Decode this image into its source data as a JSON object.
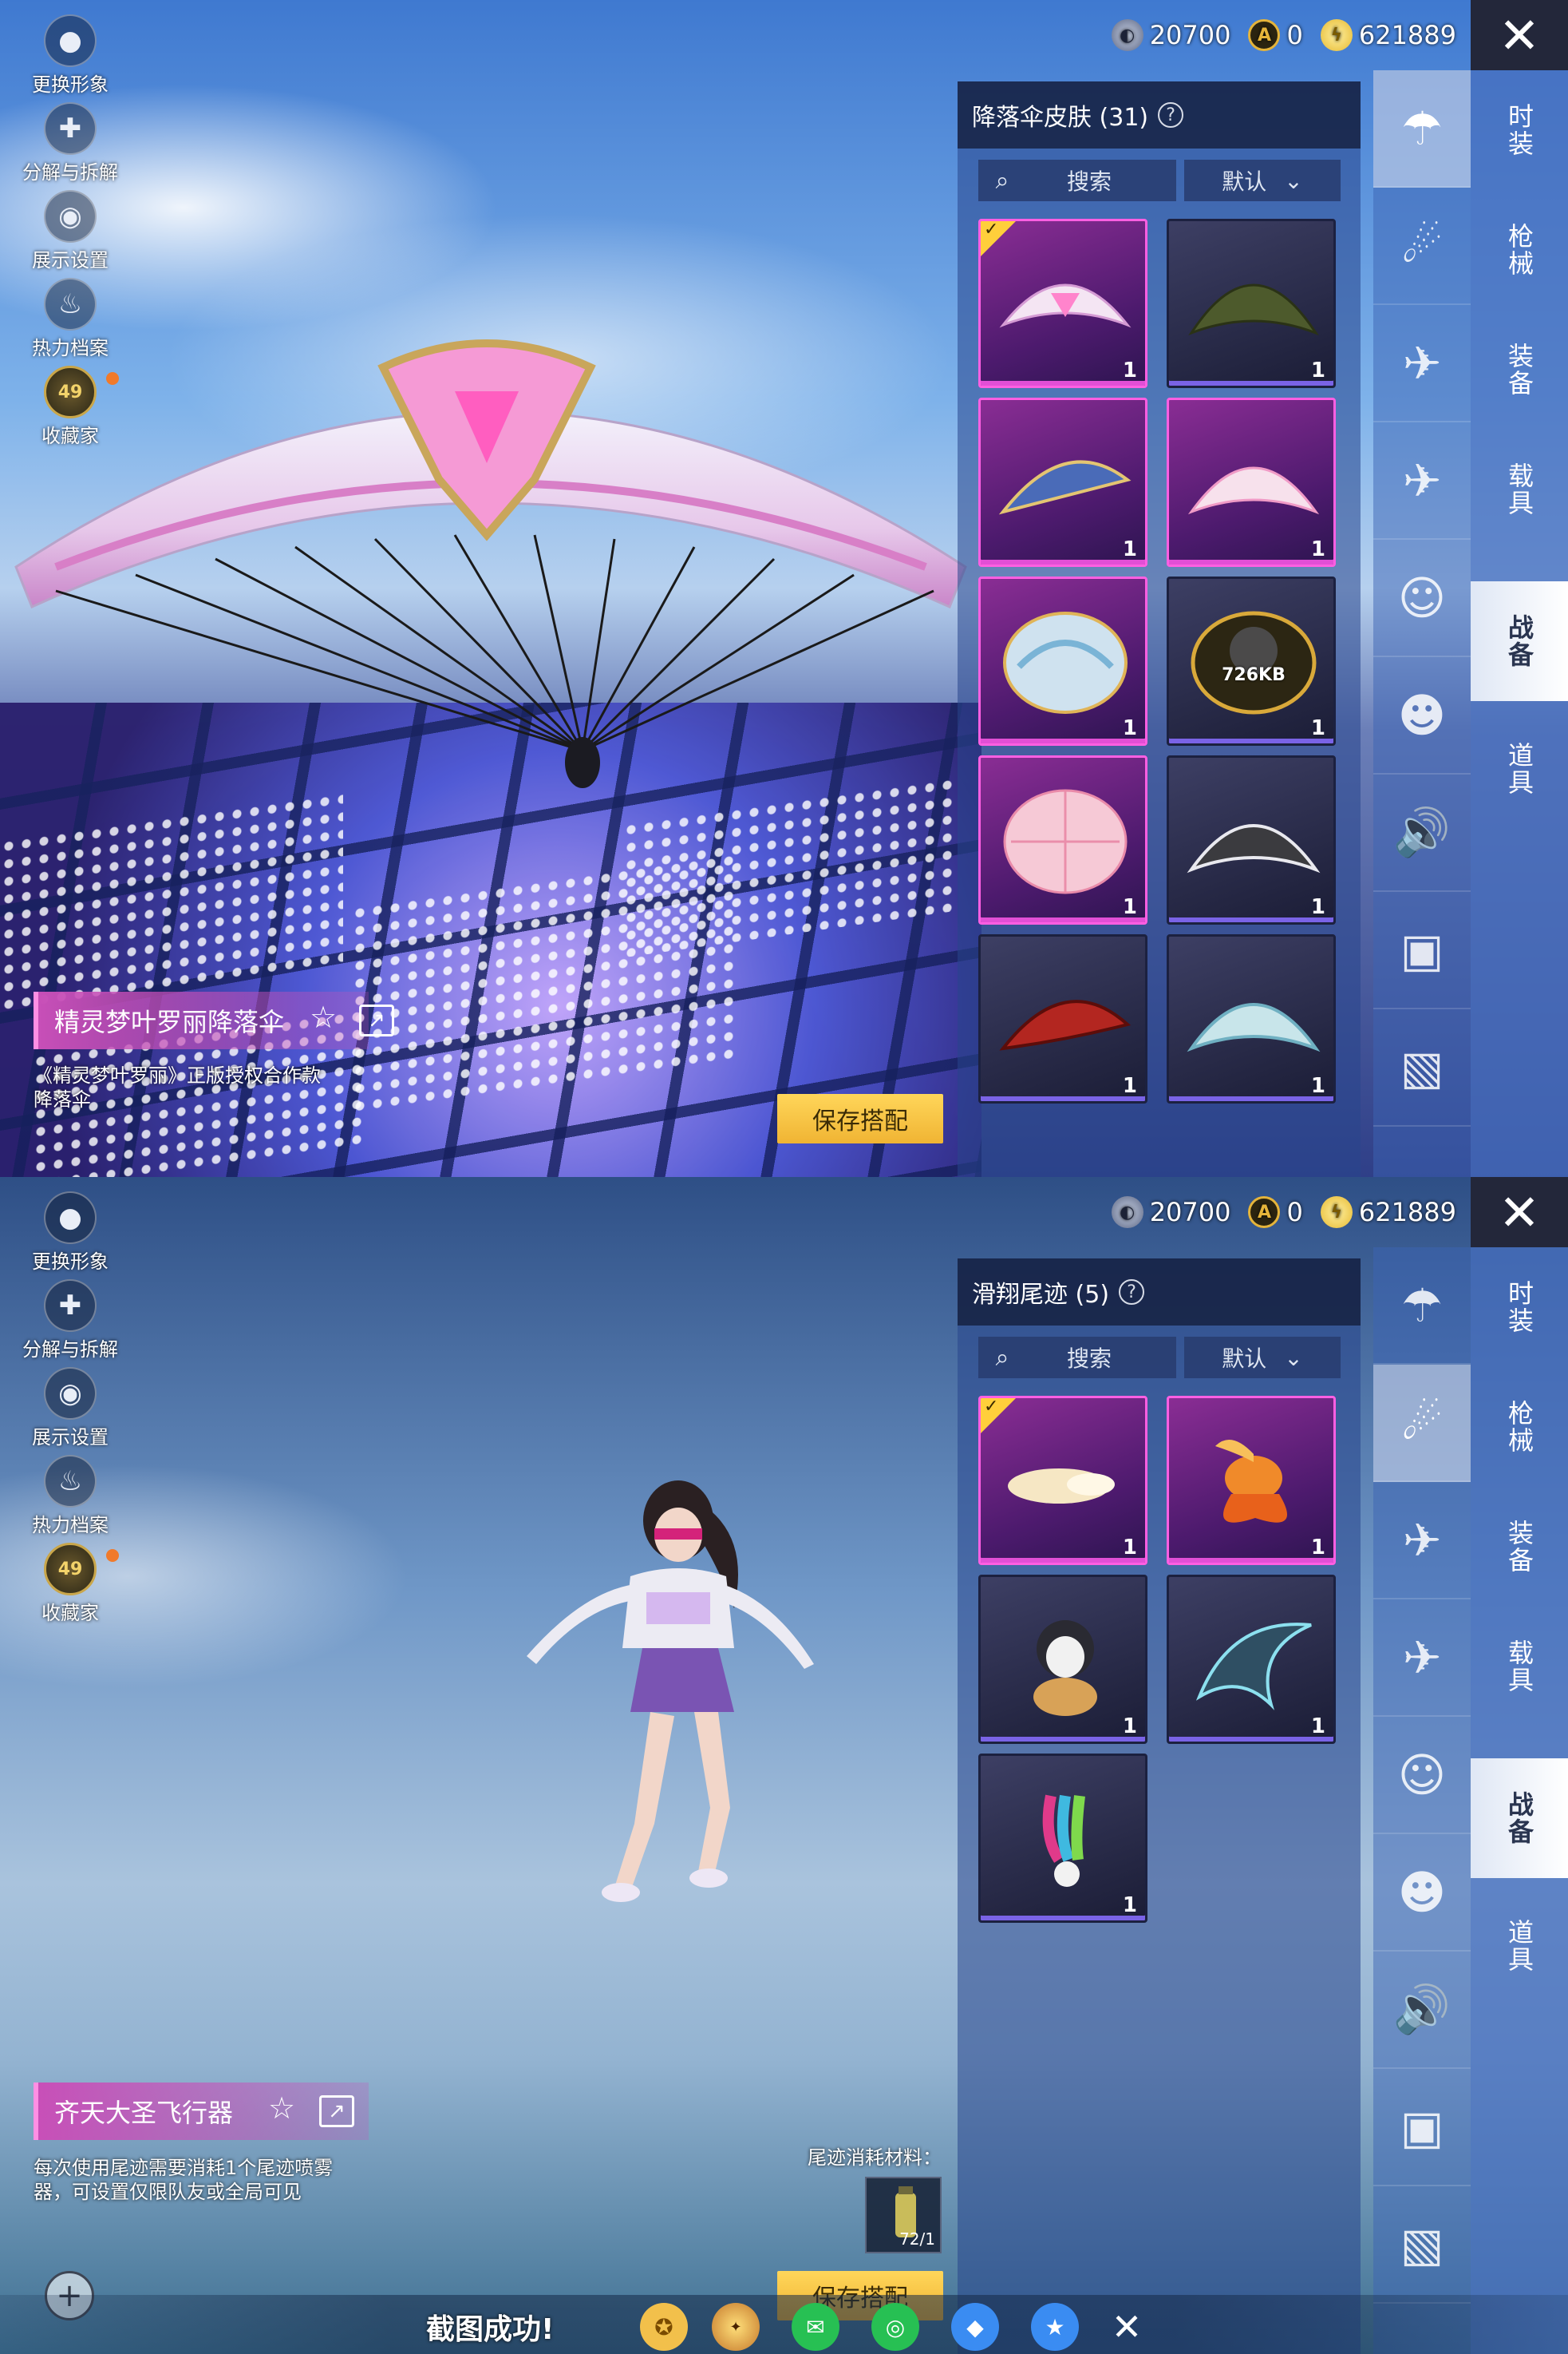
{
  "currency": {
    "coupon_value": "20700",
    "gold_value": "0",
    "coin_value": "621889"
  },
  "left_menu": {
    "items": [
      {
        "label": "更换形象",
        "icon": "avatar-icon"
      },
      {
        "label": "分解与拆解",
        "icon": "puzzle-icon"
      },
      {
        "label": "展示设置",
        "icon": "eye-icon"
      },
      {
        "label": "热力档案",
        "icon": "flame-icon"
      },
      {
        "label": "收藏家",
        "icon": "collector-level-icon",
        "level": "49"
      }
    ]
  },
  "categories": [
    "时装",
    "枪械",
    "装备",
    "载具",
    "战备",
    "道具"
  ],
  "active_category": "战备",
  "sub_icons": [
    "parachute-icon",
    "skydiver-icon",
    "plane-icon",
    "airplane-icon",
    "emote-icon",
    "companion-icon",
    "voice-icon",
    "chat-icon",
    "gallery-icon"
  ],
  "search": {
    "label": "搜索"
  },
  "sort": {
    "label": "默认"
  },
  "screen1": {
    "panel_title": "降落伞皮肤 (31)",
    "items": [
      {
        "qty": "1",
        "rarity": "purple",
        "equipped": true
      },
      {
        "qty": "1",
        "rarity": "dark"
      },
      {
        "qty": "1",
        "rarity": "purple"
      },
      {
        "qty": "1",
        "rarity": "purple"
      },
      {
        "qty": "1",
        "rarity": "purple"
      },
      {
        "qty": "1",
        "rarity": "dark",
        "size": "726KB"
      },
      {
        "qty": "1",
        "rarity": "purple"
      },
      {
        "qty": "1",
        "rarity": "dark"
      },
      {
        "qty": "1",
        "rarity": "dark"
      },
      {
        "qty": "1",
        "rarity": "dark"
      }
    ],
    "item_name": "精灵梦叶罗丽降落伞",
    "item_desc": "《精灵梦叶罗丽》正版授权合作款降落伞",
    "save_label": "保存搭配"
  },
  "screen2": {
    "panel_title": "滑翔尾迹 (5)",
    "items": [
      {
        "qty": "1",
        "rarity": "purple",
        "equipped": true
      },
      {
        "qty": "1",
        "rarity": "purple"
      },
      {
        "qty": "1",
        "rarity": "dark"
      },
      {
        "qty": "1",
        "rarity": "dark"
      },
      {
        "qty": "1",
        "rarity": "dark"
      }
    ],
    "item_name": "齐天大圣飞行器",
    "item_desc": "每次使用尾迹需要消耗1个尾迹喷雾器，可设置仅限队友或全局可见",
    "trail_material_label": "尾迹消耗材料：",
    "trail_material_qty": "72/1",
    "save_label": "保存搭配"
  },
  "share_bar": {
    "label": "截图成功!",
    "app_icons": [
      "game-center-icon",
      "peace-elite-icon",
      "wechat-icon",
      "moments-icon",
      "qq-icon",
      "qzone-icon"
    ]
  },
  "colors": {
    "accent_gold": "#ffd65a",
    "rarity_purple": "#ff5fe2",
    "active_tab": "#ffffff"
  }
}
